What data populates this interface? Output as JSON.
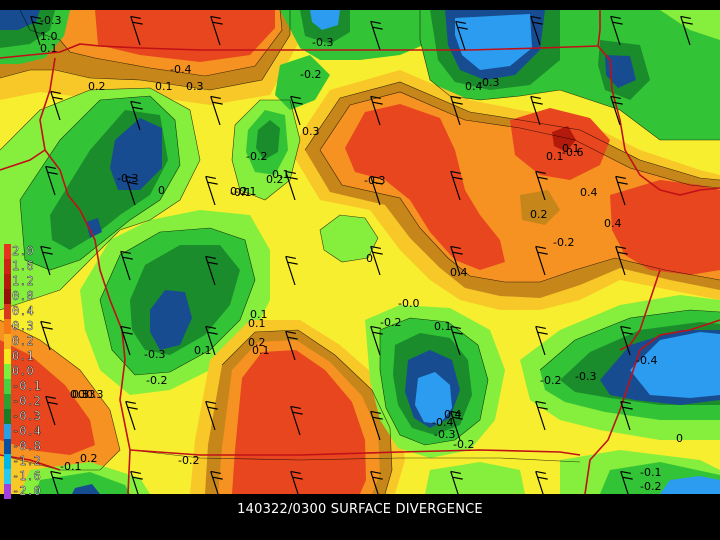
{
  "title": "140322/0300 SURFACE DIVERGENCE",
  "legend": {
    "labels": [
      "2.0",
      "1.6",
      "1.2",
      "0.8",
      "0.4",
      "0.3",
      "0.2",
      "0.1",
      "0.0",
      "-0.1",
      "-0.2",
      "-0.3",
      "-0.4",
      "-0.8",
      "-1.2",
      "-1.6",
      "-2.0"
    ],
    "colors": [
      "#e8321e",
      "#cc2414",
      "#b41a0c",
      "#961008",
      "#d8381c",
      "#f47a18",
      "#f8b020",
      "#f8e820",
      "#78f03c",
      "#48d040",
      "#2aa030",
      "#187c28",
      "#28a0e8",
      "#0850a0",
      "#00b8e8",
      "#28c8f0",
      "#a040e0"
    ]
  },
  "palette": {
    "red": "#e8461e",
    "orange": "#f69222",
    "brown": "#c6861a",
    "gold": "#f8c828",
    "yellow": "#f8ee30",
    "lime": "#86ee3c",
    "green": "#32c436",
    "darkgreen": "#1a8c2c",
    "navy": "#184c90",
    "blue": "#2c9cf0",
    "state_border": "#c01018"
  },
  "contour_labels": [
    "-0.3",
    "1.0",
    "0.1",
    "-0.3",
    "-0.4",
    "0.3",
    "-0.2",
    "0.2",
    "0.1",
    "0.3",
    "-0.2",
    "-0.3",
    "0.4",
    "-0.3",
    "0.2",
    "0.2",
    "0.1",
    "-0.2",
    "-0.1",
    "0.1",
    "0.2",
    "0.3",
    "0",
    "-0.3",
    "-0.6",
    "0.4",
    "0.2",
    "0.4",
    "-0.2",
    "0",
    "0.4",
    "-0.0",
    "0.1",
    "-0.3",
    "0.1",
    "-0.2",
    "0.1",
    "0.3",
    "0.4",
    "0.3",
    "-0.3",
    "-0.2",
    "-0.3",
    "-0.4",
    "0.3",
    "-0.4",
    "-0.2",
    "0",
    "-0.1",
    "-0.1",
    "-0.2",
    "-0.2",
    "0.2",
    "0.1",
    "0.1",
    "0.1",
    "-0.1"
  ]
}
